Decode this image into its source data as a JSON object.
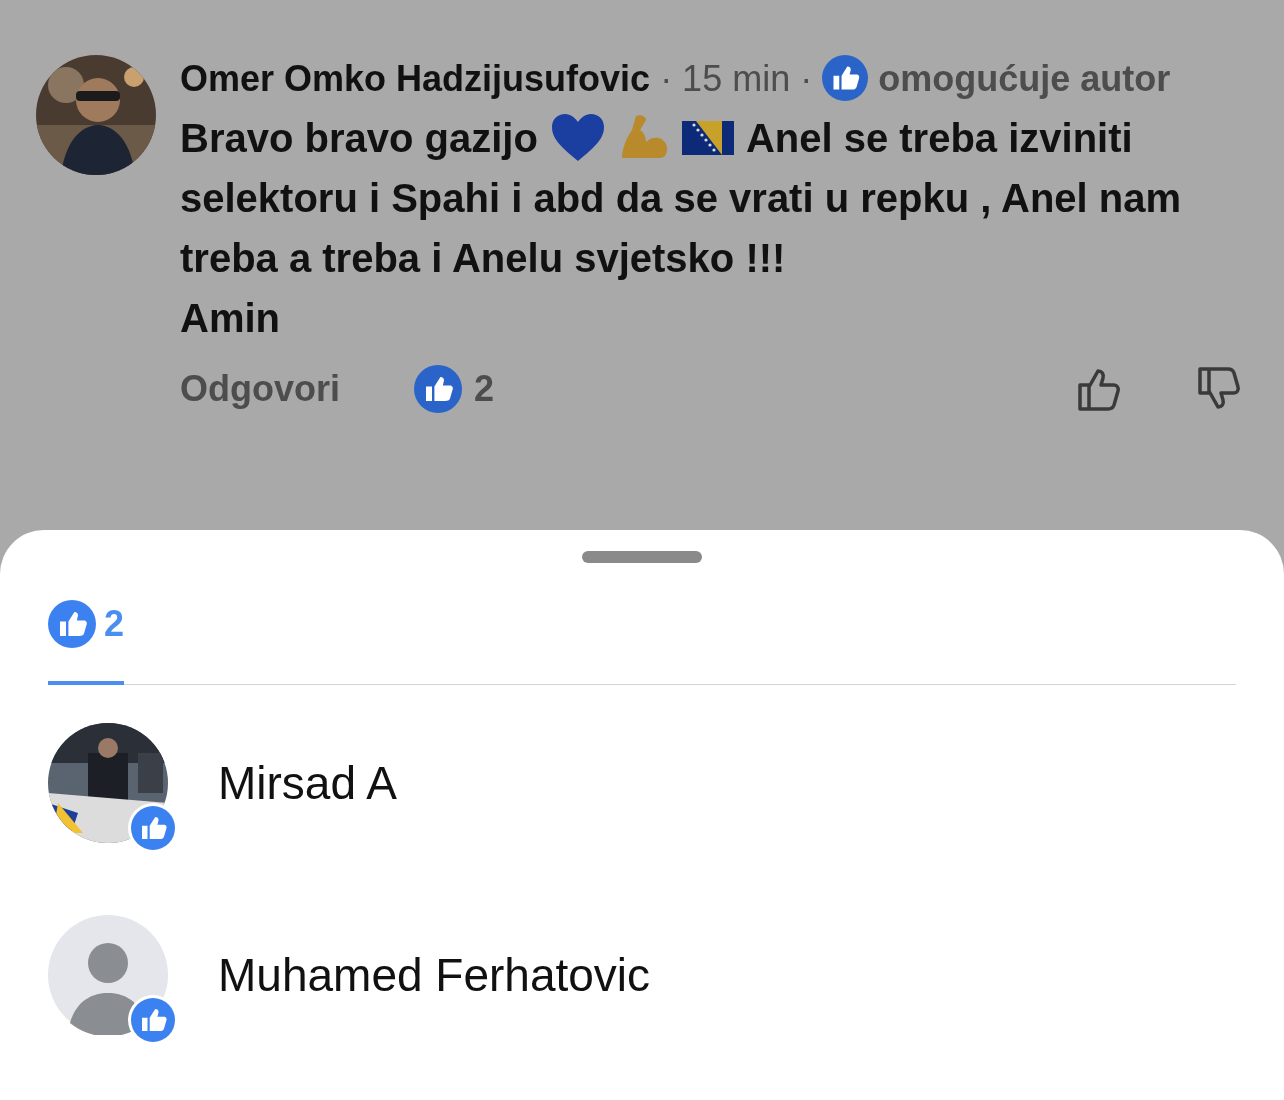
{
  "comment": {
    "author": "Omer Omko Hadzijusufovic",
    "time": "· 15 min ·",
    "badge": "omogućuje autor",
    "text_start": "Bravo bravo gazijo",
    "text_mid": "Anel se treba izviniti",
    "text_rest": "selektoru i Spahi i abd da se vrati u repku , Anel nam treba a treba i Anelu svjetsko !!!",
    "text_last": "Amin",
    "reply": "Odgovori",
    "likes": "2"
  },
  "sheet": {
    "tabs": [
      {
        "label": "2",
        "selected": true
      }
    ],
    "people": [
      {
        "name": "Mirsad A"
      },
      {
        "name": "Muhamed Ferhatovic",
        "kind": "default"
      }
    ]
  }
}
